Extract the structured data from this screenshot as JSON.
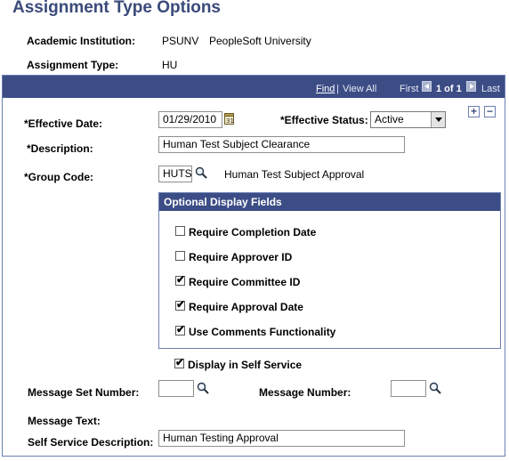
{
  "page": {
    "title": "Assignment Type Options"
  },
  "header": {
    "institution_label": "Academic Institution:",
    "institution_code": "PSUNV",
    "institution_name": "PeopleSoft University",
    "assignment_type_label": "Assignment Type:",
    "assignment_type_value": "HU"
  },
  "nav": {
    "find": "Find",
    "separator": "|",
    "view_all": "View All",
    "first": "First",
    "counter": "1 of 1",
    "last": "Last"
  },
  "form": {
    "effective_date_label": "*Effective Date:",
    "effective_date_value": "01/29/2010",
    "effective_status_label": "*Effective Status:",
    "effective_status_value": "Active",
    "description_label": "*Description:",
    "description_value": "Human Test Subject Clearance",
    "group_code_label": "*Group Code:",
    "group_code_value": "HUTS",
    "group_code_desc": "Human Test Subject Approval",
    "add_row": "+",
    "delete_row": "−"
  },
  "optional_fields": {
    "title": "Optional Display Fields",
    "items": [
      {
        "label": "Require Completion Date",
        "checked": false
      },
      {
        "label": "Require Approver ID",
        "checked": false
      },
      {
        "label": "Require Committee ID",
        "checked": true
      },
      {
        "label": "Require Approval Date",
        "checked": true
      },
      {
        "label": "Use Comments Functionality",
        "checked": true
      }
    ]
  },
  "self_service": {
    "display_label": "Display in Self Service",
    "display_checked": true,
    "message_set_label": "Message Set Number:",
    "message_set_value": "",
    "message_number_label": "Message Number:",
    "message_number_value": "",
    "message_text_label": "Message Text:",
    "description_label": "Self Service Description:",
    "description_value": "Human Testing Approval"
  },
  "icons": {
    "checkmark": "✔",
    "lookup": "lookup-icon",
    "calendar": "calendar-icon"
  }
}
